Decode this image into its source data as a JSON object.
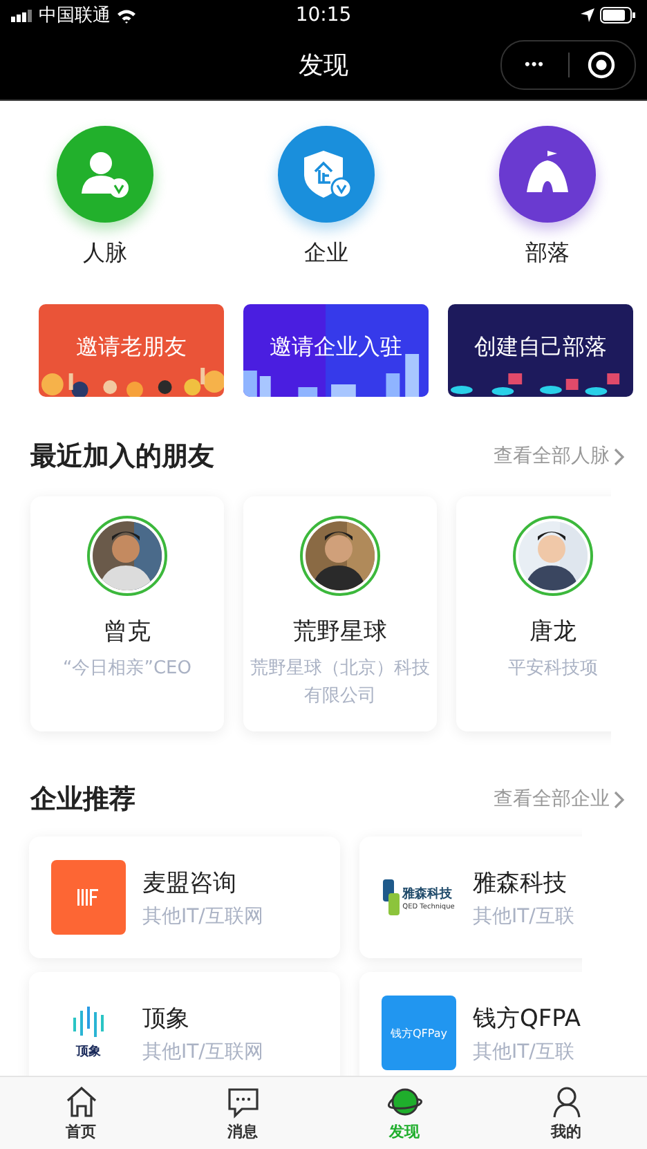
{
  "status_bar": {
    "carrier": "中国联通",
    "time": "10:15"
  },
  "nav": {
    "title": "发现",
    "more": "•••"
  },
  "features": [
    {
      "kind": "person",
      "label": "人脉",
      "color": "#22b02c"
    },
    {
      "kind": "enterprise",
      "label": "企业",
      "color": "#1a8fdc"
    },
    {
      "kind": "tribe",
      "label": "部落",
      "color": "#6a3ad0"
    }
  ],
  "banners": [
    {
      "kind": "friends",
      "label": "邀请老朋友"
    },
    {
      "kind": "city",
      "label": "邀请企业入驻"
    },
    {
      "kind": "tech",
      "label": "创建自己部落"
    }
  ],
  "friends_section": {
    "title": "最近加入的朋友",
    "link": "查看全部人脉"
  },
  "friends": [
    {
      "name": "曾克",
      "desc": "“今日相亲”CEO"
    },
    {
      "name": "荒野星球",
      "desc": "荒野星球（北京）科技有限公司"
    },
    {
      "name": "唐龙",
      "desc": "平安科技项"
    }
  ],
  "companies_section": {
    "title": "企业推荐",
    "link": "查看全部企业"
  },
  "companies": [
    {
      "name": "麦盟咨询",
      "industry": "其他IT/互联网",
      "kind": "orange"
    },
    {
      "name": "雅森科技",
      "industry": "其他IT/互联",
      "kind": "yasen",
      "logo_text": "雅森科技",
      "logo_sub": "QED Technique"
    },
    {
      "name": "顶象",
      "industry": "其他IT/互联网",
      "kind": "bars",
      "logo_text": "顶象"
    },
    {
      "name": "钱方QFPA",
      "industry": "其他IT/互联",
      "kind": "blue",
      "logo_text": "钱方QFPay"
    }
  ],
  "tabs": [
    {
      "kind": "home",
      "label": "首页",
      "selected": false
    },
    {
      "kind": "message",
      "label": "消息",
      "selected": false
    },
    {
      "kind": "discover",
      "label": "发现",
      "selected": true
    },
    {
      "kind": "me",
      "label": "我的",
      "selected": false
    }
  ]
}
